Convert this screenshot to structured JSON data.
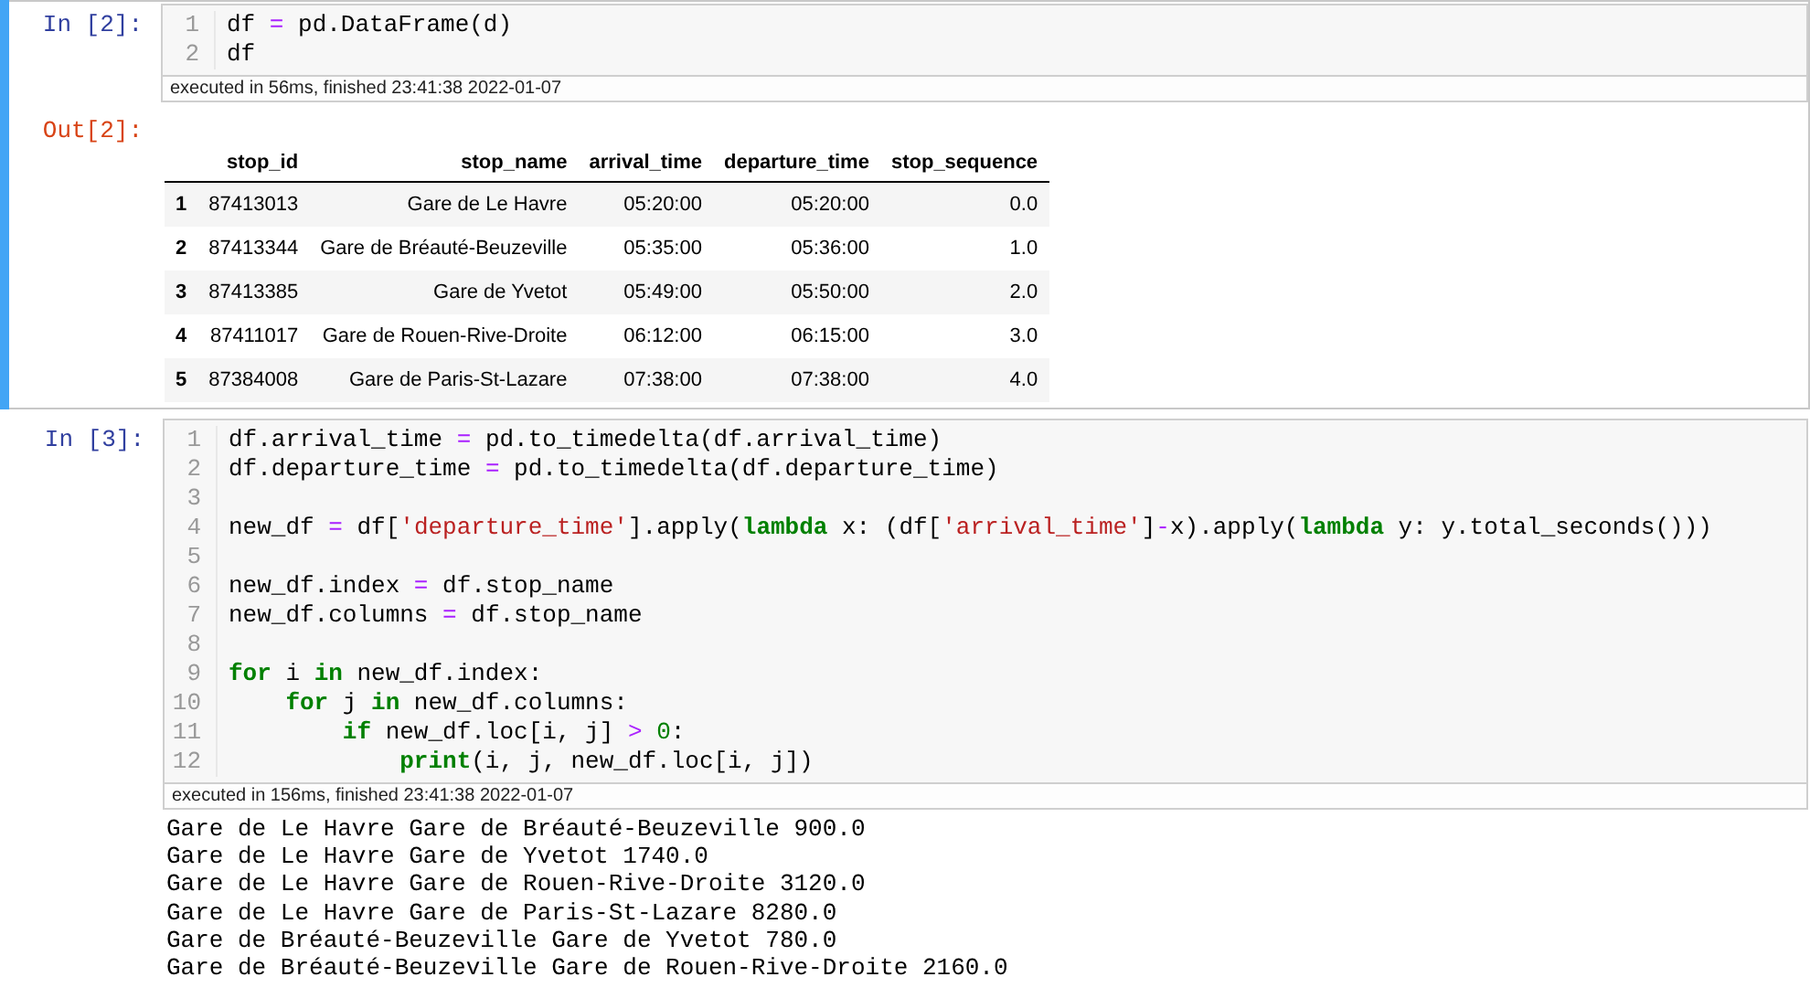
{
  "cells": [
    {
      "selected": true,
      "prompt": "In [2]:",
      "code": [
        {
          "number": "1",
          "tokens": [
            {
              "text": "df ",
              "kind": "plain"
            },
            {
              "text": "=",
              "kind": "operator"
            },
            {
              "text": " pd.DataFrame(d)",
              "kind": "plain"
            }
          ]
        },
        {
          "number": "2",
          "tokens": [
            {
              "text": "df",
              "kind": "plain"
            }
          ]
        }
      ],
      "execution": "executed in 56ms, finished 23:41:38 2022-01-07",
      "output": {
        "kind": "table",
        "prompt": "Out[2]:",
        "columns": [
          "",
          "stop_id",
          "stop_name",
          "arrival_time",
          "departure_time",
          "stop_sequence"
        ],
        "rows": [
          [
            "1",
            "87413013",
            "Gare de Le Havre",
            "05:20:00",
            "05:20:00",
            "0.0"
          ],
          [
            "2",
            "87413344",
            "Gare de Bréauté-Beuzeville",
            "05:35:00",
            "05:36:00",
            "1.0"
          ],
          [
            "3",
            "87413385",
            "Gare de Yvetot",
            "05:49:00",
            "05:50:00",
            "2.0"
          ],
          [
            "4",
            "87411017",
            "Gare de Rouen-Rive-Droite",
            "06:12:00",
            "06:15:00",
            "3.0"
          ],
          [
            "5",
            "87384008",
            "Gare de Paris-St-Lazare",
            "07:38:00",
            "07:38:00",
            "4.0"
          ]
        ]
      }
    },
    {
      "selected": false,
      "prompt": "In [3]:",
      "code": [
        {
          "number": "1",
          "tokens": [
            {
              "text": "df.arrival_time ",
              "kind": "plain"
            },
            {
              "text": "=",
              "kind": "operator"
            },
            {
              "text": " pd.to_timedelta(df.arrival_time)",
              "kind": "plain"
            }
          ]
        },
        {
          "number": "2",
          "tokens": [
            {
              "text": "df.departure_time ",
              "kind": "plain"
            },
            {
              "text": "=",
              "kind": "operator"
            },
            {
              "text": " pd.to_timedelta(df.departure_time)",
              "kind": "plain"
            }
          ]
        },
        {
          "number": "3"
        },
        {
          "number": "4",
          "tokens": [
            {
              "text": "new_df ",
              "kind": "plain"
            },
            {
              "text": "=",
              "kind": "operator"
            },
            {
              "text": " df[",
              "kind": "plain"
            },
            {
              "text": "'departure_time'",
              "kind": "string"
            },
            {
              "text": "].apply(",
              "kind": "plain"
            },
            {
              "text": "lambda",
              "kind": "keyword"
            },
            {
              "text": " x: (df[",
              "kind": "plain"
            },
            {
              "text": "'arrival_time'",
              "kind": "string"
            },
            {
              "text": "]",
              "kind": "plain"
            },
            {
              "text": "-",
              "kind": "operator"
            },
            {
              "text": "x).apply(",
              "kind": "plain"
            },
            {
              "text": "lambda",
              "kind": "keyword"
            },
            {
              "text": " y: y.total_seconds()))",
              "kind": "plain"
            }
          ]
        },
        {
          "number": "5"
        },
        {
          "number": "6",
          "tokens": [
            {
              "text": "new_df.index ",
              "kind": "plain"
            },
            {
              "text": "=",
              "kind": "operator"
            },
            {
              "text": " df.stop_name",
              "kind": "plain"
            }
          ]
        },
        {
          "number": "7",
          "tokens": [
            {
              "text": "new_df.columns ",
              "kind": "plain"
            },
            {
              "text": "=",
              "kind": "operator"
            },
            {
              "text": " df.stop_name",
              "kind": "plain"
            }
          ]
        },
        {
          "number": "8"
        },
        {
          "number": "9",
          "tokens": [
            {
              "text": "for",
              "kind": "keyword"
            },
            {
              "text": " i ",
              "kind": "plain"
            },
            {
              "text": "in",
              "kind": "keyword"
            },
            {
              "text": " new_df.index:",
              "kind": "plain"
            }
          ]
        },
        {
          "number": "10",
          "tokens": [
            {
              "text": "    for",
              "kind": "keyword"
            },
            {
              "text": " j ",
              "kind": "plain"
            },
            {
              "text": "in",
              "kind": "keyword"
            },
            {
              "text": " new_df.columns:",
              "kind": "plain"
            }
          ]
        },
        {
          "number": "11",
          "tokens": [
            {
              "text": "        if",
              "kind": "keyword"
            },
            {
              "text": " new_df.loc[i, j] ",
              "kind": "plain"
            },
            {
              "text": ">",
              "kind": "operator"
            },
            {
              "text": " 0",
              "kind": "number"
            },
            {
              "text": ":",
              "kind": "plain"
            }
          ]
        },
        {
          "number": "12",
          "tokens": [
            {
              "text": "            print",
              "kind": "builtin"
            },
            {
              "text": "(i, j, new_df.loc[i, j])",
              "kind": "plain"
            }
          ]
        }
      ],
      "execution": "executed in 156ms, finished 23:41:38 2022-01-07",
      "output": {
        "kind": "stream",
        "lines": [
          "Gare de Le Havre Gare de Bréauté-Beuzeville 900.0",
          "Gare de Le Havre Gare de Yvetot 1740.0",
          "Gare de Le Havre Gare de Rouen-Rive-Droite 3120.0",
          "Gare de Le Havre Gare de Paris-St-Lazare 8280.0",
          "Gare de Bréauté-Beuzeville Gare de Yvetot 780.0",
          "Gare de Bréauté-Beuzeville Gare de Rouen-Rive-Droite 2160.0"
        ]
      }
    }
  ]
}
